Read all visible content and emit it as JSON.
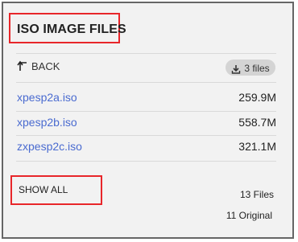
{
  "header": {
    "title": "ISO IMAGE FILES"
  },
  "nav": {
    "back_label": "BACK",
    "back_icon": "return-arrow-icon",
    "files_badge_label": "3 files",
    "files_badge_icon": "download-icon"
  },
  "files": [
    {
      "name": "xpesp2a.iso",
      "size": "259.9M"
    },
    {
      "name": "xpesp2b.iso",
      "size": "558.7M"
    },
    {
      "name": "zxpesp2c.iso",
      "size": "321.1M"
    }
  ],
  "footer": {
    "show_all_label": "SHOW ALL",
    "files_count": "13 Files",
    "original_count": "11 Original"
  },
  "colors": {
    "link": "#4a6bd0",
    "highlight": "#e8262a",
    "panel_bg": "#f2f2f2",
    "panel_border": "#666666",
    "badge_bg": "#d4d4d4"
  }
}
